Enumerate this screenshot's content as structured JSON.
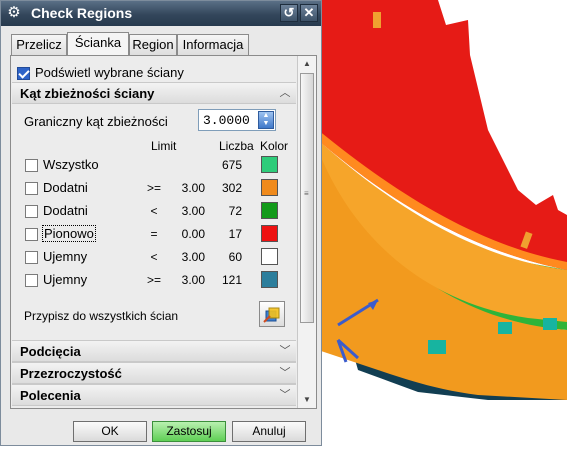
{
  "dialog": {
    "title": "Check Regions",
    "icons": {
      "gear": "gear-icon",
      "reset": "reset-icon",
      "close": "close-icon"
    }
  },
  "tabs": [
    {
      "label": "Przelicz",
      "active": false
    },
    {
      "label": "Ścianka",
      "active": true
    },
    {
      "label": "Region",
      "active": false
    },
    {
      "label": "Informacja",
      "active": false
    }
  ],
  "highlight": {
    "label": "Podświetl wybrane ściany",
    "checked": true
  },
  "sections": {
    "angle": "Kąt zbieżności ściany",
    "undercuts": "Podcięcia",
    "transparency": "Przezroczystość",
    "commands": "Polecenia"
  },
  "angle": {
    "limit_label": "Graniczny kąt zbieżności",
    "limit_value": "3.0000",
    "headers": {
      "limit": "Limit",
      "count": "Liczba",
      "color": "Kolor"
    },
    "rows": [
      {
        "name": "Wszystko",
        "op": "",
        "value": "",
        "count": "675",
        "color": "#2ecc7a"
      },
      {
        "name": "Dodatni",
        "op": ">=",
        "value": "3.00",
        "count": "302",
        "color": "#f08a1c"
      },
      {
        "name": "Dodatni",
        "op": "<",
        "value": "3.00",
        "count": "72",
        "color": "#129a1a"
      },
      {
        "name": "Pionowo",
        "op": "=",
        "value": "0.00",
        "count": "17",
        "color": "#ee1111"
      },
      {
        "name": "Ujemny",
        "op": "<",
        "value": "3.00",
        "count": "60",
        "color": "#ffffff"
      },
      {
        "name": "Ujemny",
        "op": ">=",
        "value": "3.00",
        "count": "121",
        "color": "#2c7e9c"
      }
    ],
    "assign_label": "Przypisz do wszystkich ścian"
  },
  "buttons": {
    "ok": "OK",
    "apply": "Zastosuj",
    "cancel": "Anuluj"
  },
  "colors": {
    "title_bar": "#33465b",
    "accent_apply": "#5fcf55"
  }
}
